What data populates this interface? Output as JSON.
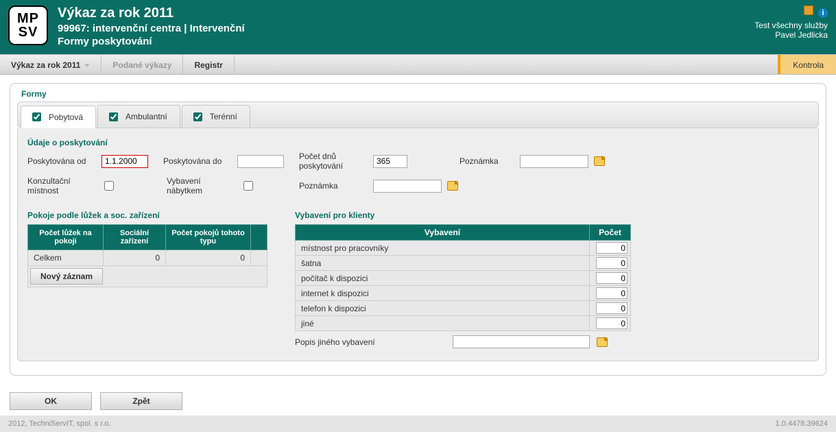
{
  "header": {
    "logo_top": "MP",
    "logo_bottom": "SV",
    "title": "Výkaz za rok 2011",
    "subtitle": "99967: intervenční centra | Intervenční",
    "subtitle2": "Formy poskytování",
    "right_line1": "Test všechny služby",
    "right_line2": "Pavel Jedlicka"
  },
  "menu": {
    "item1": "Výkaz za rok 2011",
    "item2": "Podané výkazy",
    "item3": "Registr",
    "kontrola": "Kontrola"
  },
  "panel_title": "Formy",
  "tabs": {
    "pobytova": "Pobytová",
    "ambulantni": "Ambulantní",
    "terenni": "Terénní"
  },
  "udaje": {
    "title": "Údaje o poskytování",
    "od_label": "Poskytována od",
    "od_value": "1.1.2000",
    "do_label": "Poskytována do",
    "do_value": "",
    "dnu_label": "Počet dnů poskytování",
    "dnu_value": "365",
    "pozn_label": "Poznámka",
    "pozn_value": "",
    "konzult_label": "Konzultační místnost",
    "vybaveni_label": "Vybavení nábytkem",
    "pozn2_label": "Poznámka",
    "pozn2_value": ""
  },
  "pokoje": {
    "title": "Pokoje podle lůžek a soc. zařízení",
    "h1": "Počet lůžek na pokoji",
    "h2": "Sociální zařízení",
    "h3": "Počet pokojů tohoto typu",
    "celkem_label": "Celkem",
    "celkem_v1": "0",
    "celkem_v2": "0",
    "new_btn": "Nový záznam"
  },
  "vyb": {
    "title": "Vybavení pro klienty",
    "h1": "Vybavení",
    "h2": "Počet",
    "rows": [
      {
        "label": "místnost pro pracovníky",
        "val": "0"
      },
      {
        "label": "šatna",
        "val": "0"
      },
      {
        "label": "počítač k dispozici",
        "val": "0"
      },
      {
        "label": "internet k dispozici",
        "val": "0"
      },
      {
        "label": "telefon k dispozici",
        "val": "0"
      },
      {
        "label": "jiné",
        "val": "0"
      }
    ],
    "popis_label": "Popis jiného vybavení",
    "popis_value": ""
  },
  "buttons": {
    "ok": "OK",
    "back": "Zpět"
  },
  "footer": {
    "left": "2012, TechniServIT, spol. s r.o.",
    "right": "1.0.4478.39624"
  }
}
